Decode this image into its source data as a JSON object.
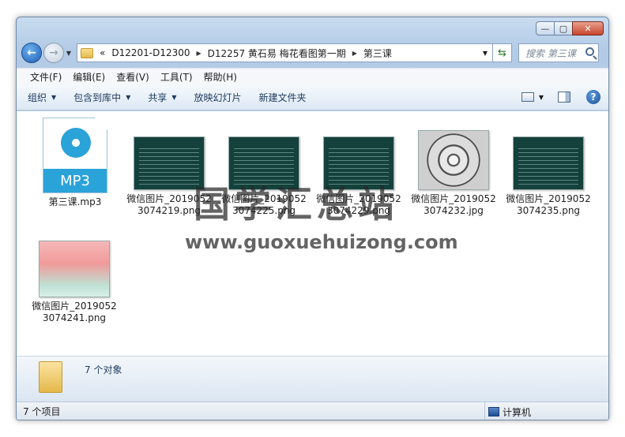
{
  "address": {
    "breadcrumbs": [
      "D12201-D12300",
      "D12257 黄石易 梅花看图第一期",
      "第三课"
    ],
    "overflow": "«"
  },
  "search": {
    "placeholder": "搜索 第三课"
  },
  "menu": [
    "文件(F)",
    "编辑(E)",
    "查看(V)",
    "工具(T)",
    "帮助(H)"
  ],
  "toolbar": {
    "organize": "组织",
    "include_in_library": "包含到库中",
    "share": "共享",
    "slideshow": "放映幻灯片",
    "new_folder": "新建文件夹"
  },
  "files": [
    {
      "name": "第三课.mp3",
      "type": "mp3-icon"
    },
    {
      "name": "微信图片_20190523074219.png",
      "type": "slide-thumb"
    },
    {
      "name": "微信图片_20190523074225.png",
      "type": "slide-thumb"
    },
    {
      "name": "微信图片_20190523074229.png",
      "type": "slide-thumb"
    },
    {
      "name": "微信图片_20190523074232.jpg",
      "type": "bagua-thumb"
    },
    {
      "name": "微信图片_20190523074235.png",
      "type": "slide-thumb"
    },
    {
      "name": "微信图片_20190523074241.png",
      "type": "pink-thumb"
    }
  ],
  "mp3_label": "MP3",
  "watermark": {
    "cn": "国学汇总站",
    "en": "www.guoxuehuizong.com"
  },
  "details": {
    "count": "7 个对象"
  },
  "status": {
    "left": "7 个项目",
    "right": "计算机"
  },
  "colors": {
    "accent": "#2aa3d9",
    "slide_bg": "#14413c",
    "close": "#c7452c"
  }
}
